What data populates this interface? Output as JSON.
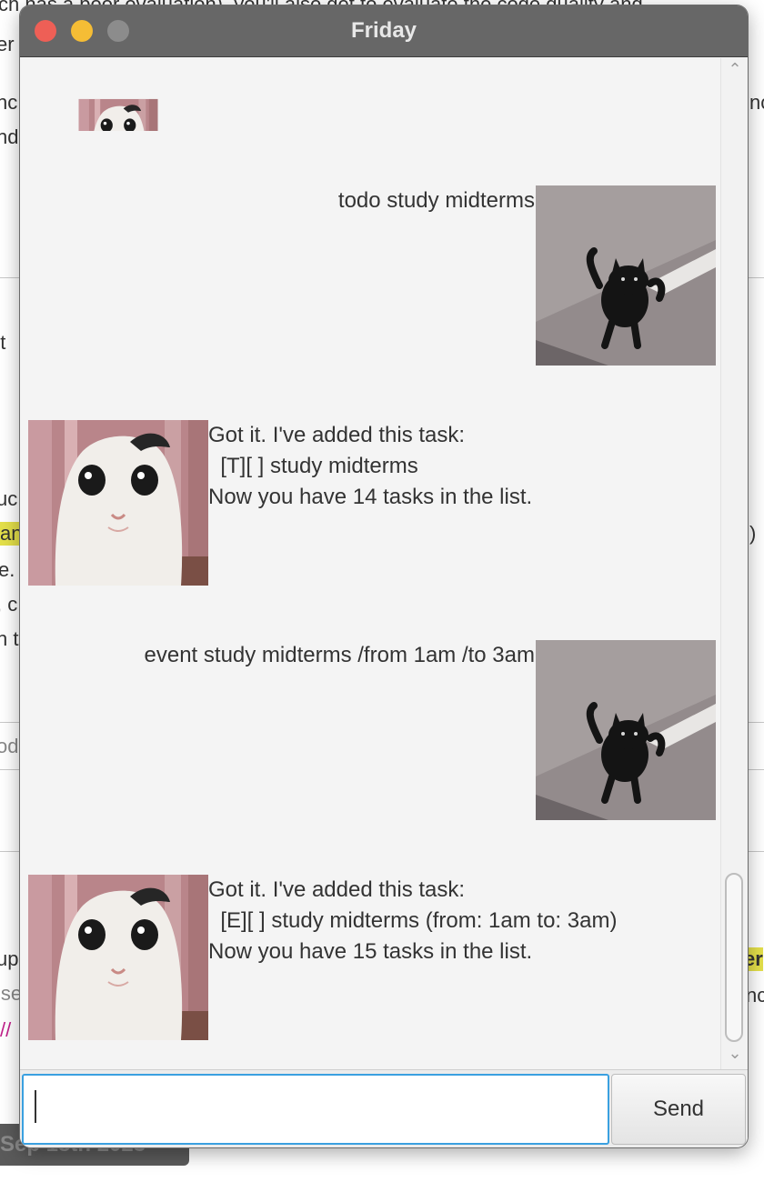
{
  "window": {
    "title": "Friday"
  },
  "background": {
    "fragments": [
      "ch has a poor evaluation), you'll also get to evaluate the code quality and",
      "er",
      "nc",
      "nd",
      "'t",
      "uc",
      "an",
      "e.",
      ", c",
      "n t",
      "od",
      "up",
      "ise",
      "//",
      "er",
      "nc",
      ")"
    ],
    "date_pill": "Sep 18th 2023"
  },
  "chat": {
    "messages": [
      {
        "sender": "friday",
        "text": ""
      },
      {
        "sender": "user",
        "text": "todo study midterms"
      },
      {
        "sender": "friday",
        "text": "Got it. I've added this task:\n  [T][ ] study midterms\nNow you have 14 tasks in the list."
      },
      {
        "sender": "user",
        "text": "event study midterms /from 1am /to 3am"
      },
      {
        "sender": "friday",
        "text": "Got it. I've added this task:\n  [E][ ] study midterms (from: 1am to: 3am)\nNow you have 15 tasks in the list."
      }
    ]
  },
  "input": {
    "value": "",
    "placeholder": ""
  },
  "send_button": {
    "label": "Send"
  },
  "icons": {
    "scroll_up": "chevron-up-icon",
    "scroll_down": "chevron-down-icon"
  },
  "colors": {
    "title_bar": "#676767",
    "close": "#ee5f56",
    "minimize": "#f5bd35",
    "focus_ring": "#3aa0e0"
  }
}
